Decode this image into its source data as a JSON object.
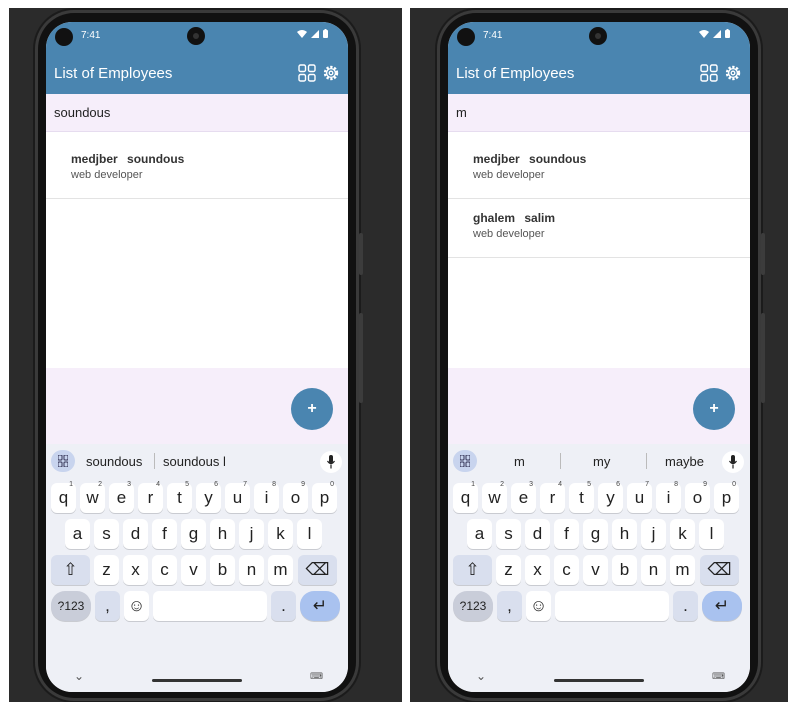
{
  "screens": [
    {
      "status_time": "7:41",
      "app_title": "List of Employees",
      "search_value": "soundous",
      "employees": [
        {
          "first": "medjber",
          "last": "soundous",
          "job": "web developer"
        }
      ],
      "fab_label": "+",
      "suggestions": [
        "soundous",
        "soundous l"
      ]
    },
    {
      "status_time": "7:41",
      "app_title": "List of Employees",
      "search_value": "m",
      "employees": [
        {
          "first": "medjber",
          "last": "soundous",
          "job": "web developer"
        },
        {
          "first": "ghalem",
          "last": "salim",
          "job": "web developer"
        }
      ],
      "fab_label": "+",
      "suggestions": [
        "m",
        "my",
        "maybe"
      ]
    }
  ],
  "keyboard": {
    "row1": [
      "q",
      "w",
      "e",
      "r",
      "t",
      "y",
      "u",
      "i",
      "o",
      "p"
    ],
    "row1_hints": [
      "1",
      "2",
      "3",
      "4",
      "5",
      "6",
      "7",
      "8",
      "9",
      "0"
    ],
    "row2": [
      "a",
      "s",
      "d",
      "f",
      "g",
      "h",
      "j",
      "k",
      "l"
    ],
    "row3": [
      "z",
      "x",
      "c",
      "v",
      "b",
      "n",
      "m"
    ],
    "shift": "⇧",
    "backspace": "⌫",
    "numbers": "?123",
    "comma": ",",
    "emoji": "☺",
    "period": ".",
    "enter": "↵"
  },
  "nav": {
    "chevron": "⌄",
    "kbd_switch": "⌨"
  },
  "colors": {
    "appbar": "#4a85b0",
    "surface": "#f6eefa",
    "keyboard": "#eef0f6",
    "enter": "#a9c2ef"
  }
}
